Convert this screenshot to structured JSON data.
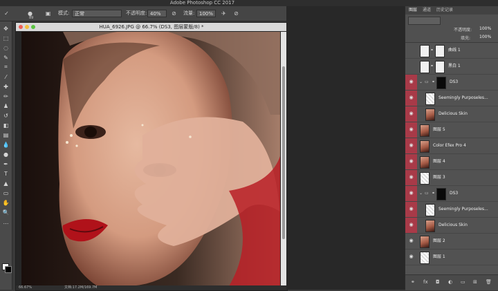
{
  "app": {
    "title": "Adobe Photoshop CC 2017"
  },
  "options": {
    "size_value": "89",
    "mode_label": "模式:",
    "mode_value": "正常",
    "opacity_label": "不透明度:",
    "opacity_value": "40%",
    "flow_label": "流量:",
    "flow_value": "100%"
  },
  "document": {
    "tab_title": "HUA_6926.JPG @ 66.7% (DS3, 图层蒙版/8) *",
    "status_zoom": "66.67%",
    "status_doc": "文档:17.2M/169.7M"
  },
  "panels": {
    "tabs": [
      "图层",
      "通道",
      "历史记录"
    ],
    "opacity_label": "不透明度:",
    "opacity_value": "100%",
    "fill_label": "填充:",
    "fill_value": "100%"
  },
  "layers": [
    {
      "name": "曲线 1",
      "thumb": "white",
      "mask": true,
      "visible": false,
      "red": false,
      "indent": 0
    },
    {
      "name": "黑白 1",
      "thumb": "white",
      "mask": true,
      "visible": false,
      "red": false,
      "indent": 0
    },
    {
      "name": "DS3",
      "thumb": "folder",
      "mask": "black",
      "visible": true,
      "red": true,
      "indent": 0
    },
    {
      "name": "Seemingly Purposeles...",
      "thumb": "checker",
      "mask": false,
      "visible": true,
      "red": true,
      "indent": 1
    },
    {
      "name": "Delicious Skin",
      "thumb": "photo",
      "mask": false,
      "visible": true,
      "red": true,
      "indent": 1
    },
    {
      "name": "图层 5",
      "thumb": "photo",
      "mask": false,
      "visible": true,
      "red": true,
      "indent": 0
    },
    {
      "name": "Color Efex Pro 4",
      "thumb": "photo",
      "mask": false,
      "visible": true,
      "red": true,
      "indent": 0
    },
    {
      "name": "图层 4",
      "thumb": "photo",
      "mask": false,
      "visible": true,
      "red": true,
      "indent": 0
    },
    {
      "name": "图层 3",
      "thumb": "checker",
      "mask": false,
      "visible": true,
      "red": true,
      "indent": 0
    },
    {
      "name": "DS3",
      "thumb": "folder",
      "mask": "black",
      "visible": true,
      "red": true,
      "indent": 0
    },
    {
      "name": "Seemingly Purposeles...",
      "thumb": "checker",
      "mask": false,
      "visible": true,
      "red": true,
      "indent": 1
    },
    {
      "name": "Delicious Skin",
      "thumb": "photo",
      "mask": false,
      "visible": true,
      "red": true,
      "indent": 1
    },
    {
      "name": "图层 2",
      "thumb": "photo",
      "mask": false,
      "visible": true,
      "red": false,
      "indent": 0
    },
    {
      "name": "图层 1",
      "thumb": "checker",
      "mask": false,
      "visible": true,
      "red": false,
      "indent": 0
    }
  ],
  "colors": {
    "layer_red": "#a83a48",
    "panel_bg": "#535353"
  }
}
